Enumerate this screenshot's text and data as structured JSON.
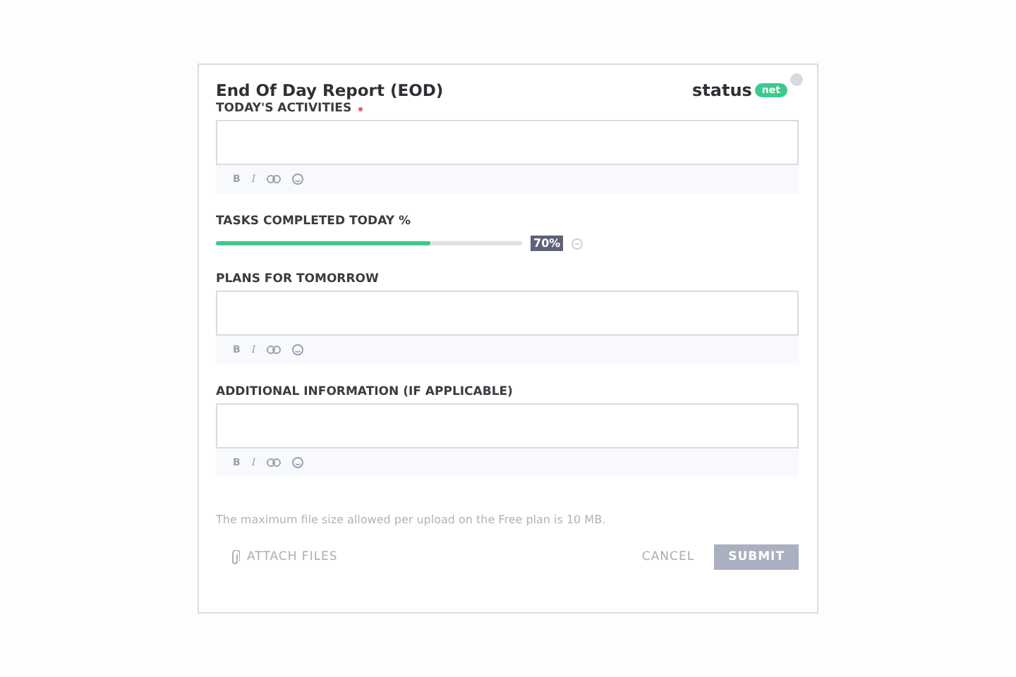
{
  "form": {
    "title": "End Of Day Report (EOD)",
    "logo": {
      "text": "status",
      "badge": "net"
    }
  },
  "fields": [
    {
      "kind": "editor",
      "label": "TODAY'S ACTIVITIES",
      "required": true,
      "toolbar": [
        "B",
        "I"
      ]
    },
    {
      "kind": "slider",
      "label": "TASKS COMPLETED TODAY %",
      "required": false,
      "level": 0.7,
      "reading": "70%"
    },
    {
      "kind": "editor",
      "label": "PLANS FOR TOMORROW",
      "required": false,
      "toolbar": [
        "B",
        "I"
      ]
    },
    {
      "kind": "editor",
      "label": "ADDITIONAL INFORMATION (IF APPLICABLE)",
      "required": false,
      "toolbar": [
        "B",
        "I"
      ]
    }
  ],
  "note": "The maximum file size allowed per upload on the Free plan is 10 MB.",
  "footer": {
    "attach": "ATTACH FILES",
    "cancel": "CANCEL",
    "submit": {
      "label": "SUBMIT",
      "disabled": true
    }
  }
}
